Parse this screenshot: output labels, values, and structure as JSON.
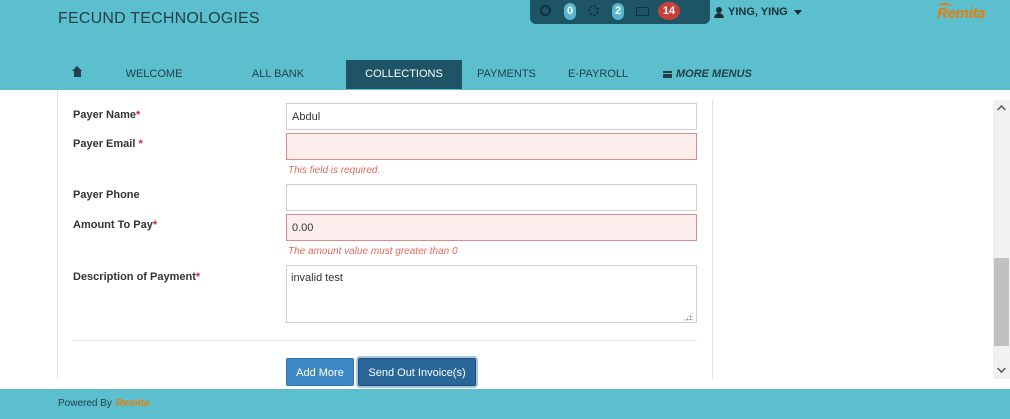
{
  "header": {
    "brand": "FECUND TECHNOLOGIES",
    "notifications": [
      {
        "icon": "alert-circle-icon",
        "count": "0",
        "color": "#58b5cf"
      },
      {
        "icon": "gear-icon",
        "count": "2",
        "color": "#58b5cf"
      },
      {
        "icon": "mail-icon",
        "count": "14",
        "color": "#c9403a"
      }
    ],
    "user": "YING, YING",
    "logo": "Remita"
  },
  "nav": {
    "home_icon": "home-icon",
    "items": [
      "WELCOME",
      "ALL BANK BALANCES",
      "COLLECTIONS",
      "PAYMENTS",
      "E-PAYROLL"
    ],
    "active": "COLLECTIONS",
    "more": "MORE MENUS"
  },
  "form": {
    "payer_name": {
      "label": "Payer Name",
      "required_mark": "*",
      "value": "Abdul"
    },
    "payer_email": {
      "label": "Payer Email ",
      "required_mark": "*",
      "value": "",
      "error": "This field is required."
    },
    "payer_phone": {
      "label": "Payer Phone",
      "value": ""
    },
    "amount": {
      "label": "Amount To Pay",
      "required_mark": "*",
      "value": "0.00",
      "error": "The amount value must greater than 0"
    },
    "description": {
      "label": "Description of Payment",
      "required_mark": "*",
      "value": "invalid test"
    },
    "add_more_label": "Add More",
    "send_label": "Send Out Invoice(s)"
  },
  "colors": {
    "header_bg": "#5bbfcd",
    "nav_active_bg": "#1d5566",
    "error_bg": "#fdeeee",
    "error_text": "#e06a5f",
    "primary_button": "#3d88c5",
    "logo_orange": "#e67e0b"
  },
  "footer": {
    "powered_by": "Powered By",
    "logo": "Remita"
  }
}
